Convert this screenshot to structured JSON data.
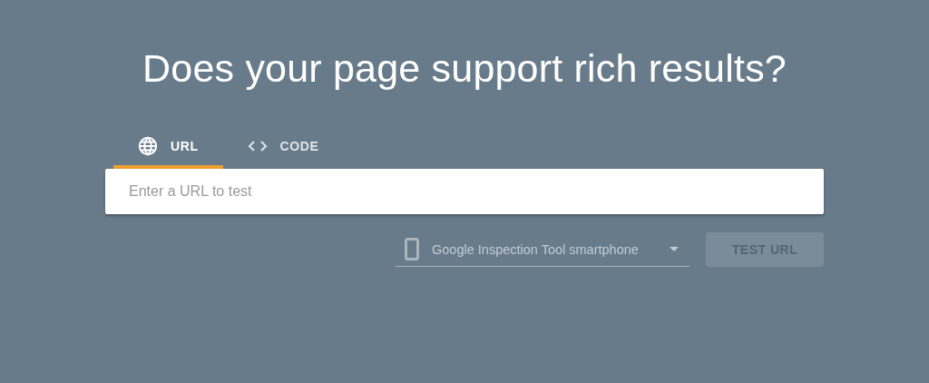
{
  "heading": "Does your page support rich results?",
  "tabs": [
    {
      "kind": "globe",
      "label": "URL",
      "selected": true
    },
    {
      "kind": "code",
      "label": "CODE",
      "selected": false
    }
  ],
  "url_field": {
    "placeholder": "Enter a URL to test"
  },
  "agent_select": {
    "value": "Google Inspection Tool smartphone"
  },
  "test_button": {
    "label": "TEST URL",
    "disabled": true
  }
}
